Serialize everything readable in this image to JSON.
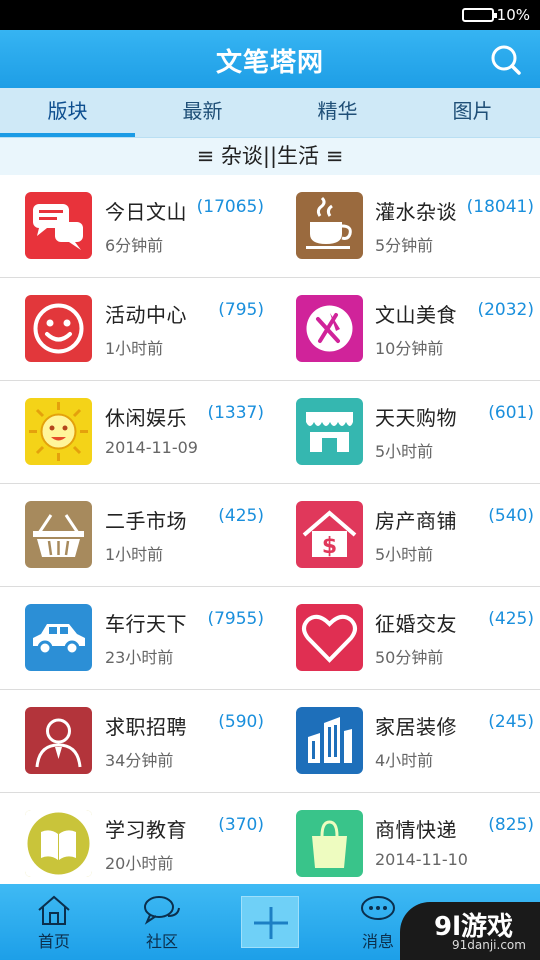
{
  "status": {
    "battery": "10%"
  },
  "header": {
    "title": "文笔塔网",
    "search_icon": "search-icon"
  },
  "tabs": [
    {
      "label": "版块",
      "active": true
    },
    {
      "label": "最新",
      "active": false
    },
    {
      "label": "精华",
      "active": false
    },
    {
      "label": "图片",
      "active": false
    }
  ],
  "section_title": "≡ 杂谈||生活 ≡",
  "forums": [
    {
      "name": "今日文山",
      "count": "(17065)",
      "time": "6分钟前",
      "icon": "chat-bubbles-icon",
      "color": "#e8333b"
    },
    {
      "name": "灌水杂谈",
      "count": "(18041)",
      "time": "5分钟前",
      "icon": "coffee-cup-icon",
      "color": "#9a6a3e"
    },
    {
      "name": "活动中心",
      "count": "(795)",
      "time": "1小时前",
      "icon": "smiley-icon",
      "color": "#e2373b"
    },
    {
      "name": "文山美食",
      "count": "(2032)",
      "time": "10分钟前",
      "icon": "fork-knife-icon",
      "color": "#d0239a"
    },
    {
      "name": "休闲娱乐",
      "count": "(1337)",
      "time": "2014-11-09",
      "icon": "sun-icon",
      "color": "#f4d318"
    },
    {
      "name": "天天购物",
      "count": "(601)",
      "time": "5小时前",
      "icon": "shop-icon",
      "color": "#35b7b0"
    },
    {
      "name": "二手市场",
      "count": "(425)",
      "time": "1小时前",
      "icon": "basket-icon",
      "color": "#a78a5d"
    },
    {
      "name": "房产商铺",
      "count": "(540)",
      "time": "5小时前",
      "icon": "house-dollar-icon",
      "color": "#e0385b"
    },
    {
      "name": "车行天下",
      "count": "(7955)",
      "time": "23小时前",
      "icon": "car-icon",
      "color": "#2c8fd6"
    },
    {
      "name": "征婚交友",
      "count": "(425)",
      "time": "50分钟前",
      "icon": "heart-icon",
      "color": "#e02f52"
    },
    {
      "name": "求职招聘",
      "count": "(590)",
      "time": "34分钟前",
      "icon": "person-tie-icon",
      "color": "#b3343b"
    },
    {
      "name": "家居装修",
      "count": "(245)",
      "time": "4小时前",
      "icon": "building-icon",
      "color": "#1e6fba"
    },
    {
      "name": "学习教育",
      "count": "(370)",
      "time": "20小时前",
      "icon": "book-icon",
      "color": "#c9c43a"
    },
    {
      "name": "商情快递",
      "count": "(825)",
      "time": "2014-11-10",
      "icon": "shopping-bag-icon",
      "color": "#39c48a"
    }
  ],
  "bottom_nav": [
    {
      "label": "首页",
      "icon": "home-icon"
    },
    {
      "label": "社区",
      "icon": "chat-icon"
    },
    {
      "label": "",
      "icon": "plus-icon"
    },
    {
      "label": "消息",
      "icon": "message-icon"
    }
  ],
  "watermark": {
    "logo": "9l游戏",
    "url": "91danji.com"
  }
}
